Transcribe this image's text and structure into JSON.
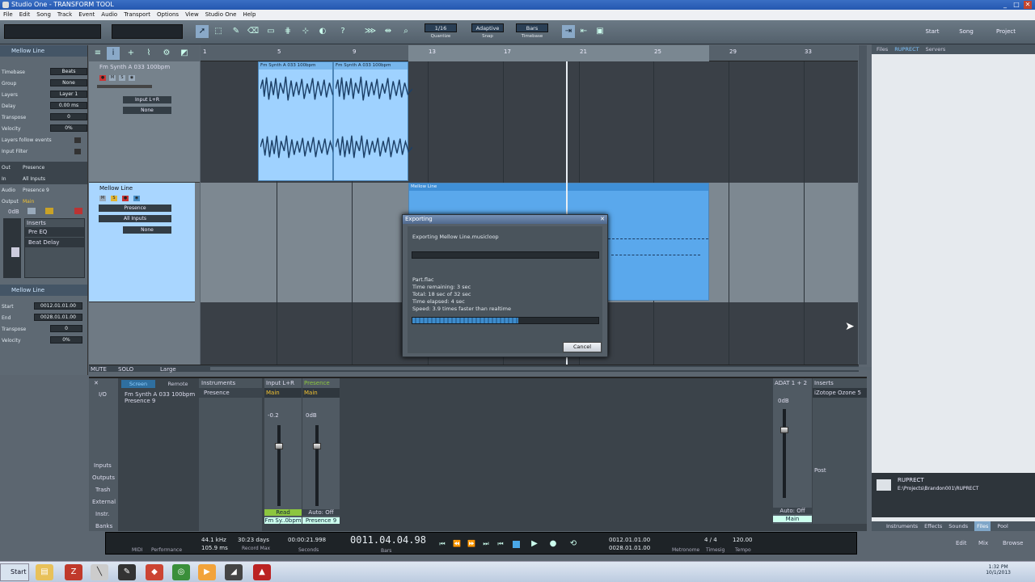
{
  "window": {
    "title": "Studio One - TRANSFORM TOOL",
    "controls": [
      "_",
      "□",
      "✕"
    ]
  },
  "menu": [
    "File",
    "Edit",
    "Song",
    "Track",
    "Event",
    "Audio",
    "Transport",
    "Options",
    "View",
    "Studio One",
    "Help"
  ],
  "toolbar": {
    "quantize": {
      "value": "1/16",
      "label": "Quantize"
    },
    "snap": {
      "value": "Adaptive",
      "label": "Snap"
    },
    "timebase": {
      "value": "Bars",
      "label": "Timebase"
    },
    "nav": [
      "Start",
      "Song",
      "Project"
    ]
  },
  "inspector": {
    "track_name": "Mellow Line",
    "rows": [
      {
        "label": "Timebase",
        "value": "Beats"
      },
      {
        "label": "Group",
        "value": "None"
      },
      {
        "label": "Layers",
        "value": "Layer 1"
      },
      {
        "label": "Delay",
        "value": "0.00 ms"
      },
      {
        "label": "Transpose",
        "value": "0"
      },
      {
        "label": "Velocity",
        "value": "0%"
      },
      {
        "label": "Layers follow events",
        "value": ""
      },
      {
        "label": "Input Filter",
        "value": ""
      }
    ],
    "out": "Out",
    "out_val": "Presence",
    "in": "In",
    "in_val": "All Inputs",
    "audio": "Audio",
    "audio_val": "Presence 9",
    "output": "Output",
    "output_val": "Main",
    "level": "0dB",
    "inserts_label": "Inserts",
    "inserts": [
      "Pre EQ",
      "Beat Delay"
    ],
    "event_name": "Mellow Line",
    "event_rows": [
      {
        "label": "Start",
        "value": "0012.01.01.00"
      },
      {
        "label": "End",
        "value": "0028.01.01.00"
      },
      {
        "label": "Transpose",
        "value": "0"
      },
      {
        "label": "Velocity",
        "value": "0%"
      }
    ]
  },
  "tracks": [
    {
      "name": "Fm Synth A 033 100bpm",
      "input": "Input L+R",
      "group": "None"
    },
    {
      "name": "Mellow Line",
      "instrument": "Presence",
      "input": "All Inputs",
      "group": "None"
    }
  ],
  "ruler": [
    "1",
    "5",
    "9",
    "13",
    "17",
    "21",
    "25",
    "29",
    "33"
  ],
  "clips": {
    "audio1": "Fm Synth A 033 100bpm",
    "audio2": "Fm Synth A 033 100bpm",
    "instrument": "Mellow Line"
  },
  "bottom_left": {
    "mute": "MUTE",
    "solo": "SOLO",
    "size": "Large"
  },
  "browser": {
    "tabs": [
      "Files",
      "RUPRECT",
      "Servers"
    ],
    "selected": {
      "name": "RUPRECT",
      "path": "E:\\Projects\\Brandon001\\RUPRECT"
    },
    "footer": [
      "Instruments",
      "Effects",
      "Sounds",
      "Files",
      "Pool"
    ]
  },
  "console": {
    "tabs": [
      "Screen",
      "Remote"
    ],
    "io": "I/O",
    "instruments_label": "Instruments",
    "instrument_items": [
      "Fm Synth A 033 100bpm",
      "Presence 9"
    ],
    "presence": "Presence",
    "side": [
      "Inputs",
      "Outputs",
      "Trash",
      "External",
      "Instr.",
      "Banks"
    ],
    "ch1": {
      "input": "Input L+R",
      "out": "Main",
      "pan": "-0.2",
      "mode": "Read",
      "name": "Fm Sy..0bpm"
    },
    "ch2": {
      "input": "Presence",
      "out": "Main",
      "pan": "0dB",
      "mode": "Auto: Off",
      "name": "Presence 9"
    },
    "adat": "ADAT 1 + 2",
    "adat_level": "0dB",
    "inserts": "Inserts",
    "plugin": "iZotope Ozone 5",
    "post": "Post",
    "main_mode": "Auto: Off",
    "main_name": "Main"
  },
  "transport": {
    "midi": "MIDI",
    "perf": "Performance",
    "rate": "44.1 kHz",
    "record_time": "30:23 days",
    "record_label": "Record Max",
    "latency": "105.9 ms",
    "seconds": "00:00:21.998",
    "seconds_label": "Seconds",
    "bars": "0011.04.04.98",
    "bars_label": "Bars",
    "loop_start": "0012.01.01.00",
    "loop_end": "0028.01.01.00",
    "metronome": "Metronome",
    "timesig": "4 / 4",
    "timesig_label": "Timesig",
    "tempo": "120.00",
    "tempo_label": "Tempo"
  },
  "view_switch": [
    "Edit",
    "Mix",
    "Browse"
  ],
  "dialog": {
    "title": "Exporting",
    "heading": "Exporting Mellow Line.musicloop",
    "file": "Part.flac",
    "remaining": "Time remaining:  3 sec",
    "total": "Total:  18 sec of 32 sec",
    "elapsed": "Time elapsed:  4 sec",
    "speed": "Speed: 3.9 times faster than realtime",
    "progress_fraction": 0.57,
    "cancel": "Cancel"
  },
  "taskbar": {
    "start": "Start",
    "time": "1:32 PM",
    "date": "10/1/2013"
  }
}
